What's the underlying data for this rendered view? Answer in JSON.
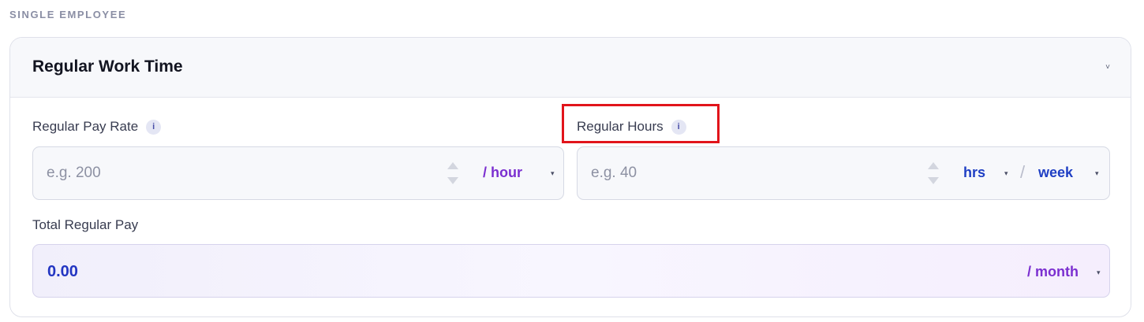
{
  "section_title": "SINGLE EMPLOYEE",
  "card": {
    "title": "Regular Work Time",
    "collapse_glyph": "˅"
  },
  "pay_rate": {
    "label": "Regular Pay Rate",
    "info_glyph": "i",
    "placeholder": "e.g. 200",
    "unit": "/ hour",
    "unit_arrow": "▾"
  },
  "hours": {
    "label": "Regular Hours",
    "info_glyph": "i",
    "placeholder": "e.g. 40",
    "unit": "hrs",
    "unit_arrow": "▾",
    "separator": "/",
    "period": "week",
    "period_arrow": "▾"
  },
  "total": {
    "label": "Total Regular Pay",
    "value": "0.00",
    "period": "/ month",
    "period_arrow": "▾"
  },
  "colors": {
    "accent_purple": "#7b2fd0",
    "accent_blue": "#1f3fc4",
    "highlight_red": "#e1141b"
  },
  "icons": {
    "info": "info-icon",
    "stepper": "stepper-arrows-icon",
    "dropdown": "chevron-down-icon"
  }
}
